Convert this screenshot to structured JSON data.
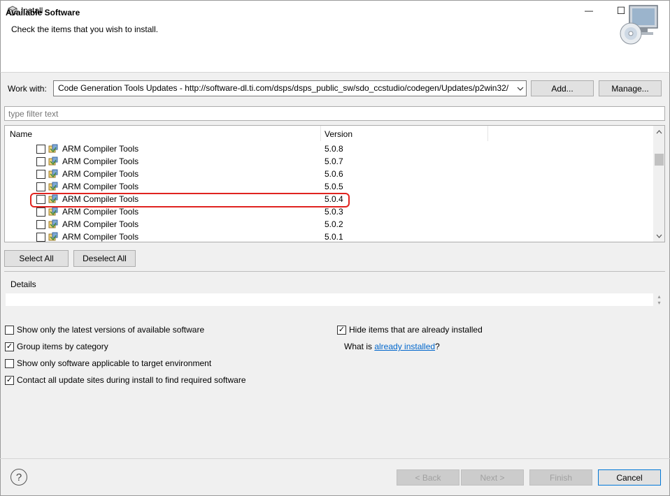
{
  "window": {
    "title": "Install",
    "minimize_glyph": "—",
    "maximize_glyph": "☐",
    "close_glyph": "✕"
  },
  "banner": {
    "title": "Available Software",
    "subtitle": "Check the items that you wish to install.",
    "icon": "install-cd-computer-icon"
  },
  "work_with": {
    "label": "Work with:",
    "value": "Code Generation Tools Updates - http://software-dl.ti.com/dsps/dsps_public_sw/sdo_ccstudio/codegen/Updates/p2win32/",
    "add_label": "Add...",
    "manage_label": "Manage..."
  },
  "filter": {
    "placeholder": "type filter text"
  },
  "table": {
    "columns": [
      "Name",
      "Version"
    ],
    "rows": [
      {
        "name": "ARM Compiler Tools",
        "version": "5.0.8",
        "checked": false,
        "highlighted": false
      },
      {
        "name": "ARM Compiler Tools",
        "version": "5.0.7",
        "checked": false,
        "highlighted": false
      },
      {
        "name": "ARM Compiler Tools",
        "version": "5.0.6",
        "checked": false,
        "highlighted": false
      },
      {
        "name": "ARM Compiler Tools",
        "version": "5.0.5",
        "checked": false,
        "highlighted": false
      },
      {
        "name": "ARM Compiler Tools",
        "version": "5.0.4",
        "checked": false,
        "highlighted": true
      },
      {
        "name": "ARM Compiler Tools",
        "version": "5.0.3",
        "checked": false,
        "highlighted": false
      },
      {
        "name": "ARM Compiler Tools",
        "version": "5.0.2",
        "checked": false,
        "highlighted": false
      },
      {
        "name": "ARM Compiler Tools",
        "version": "5.0.1",
        "checked": false,
        "highlighted": false
      }
    ],
    "highlight_color": "#e0231f"
  },
  "selection": {
    "select_all": "Select All",
    "deselect_all": "Deselect All"
  },
  "details": {
    "label": "Details"
  },
  "options": {
    "latest_versions": {
      "label": "Show only the latest versions of available software",
      "checked": false
    },
    "group_by_category": {
      "label": "Group items by category",
      "checked": true
    },
    "target_env": {
      "label": "Show only software applicable to target environment",
      "checked": false
    },
    "contact_sites": {
      "label": "Contact all update sites during install to find required software",
      "checked": true
    },
    "hide_installed": {
      "label": "Hide items that are already installed",
      "checked": true
    },
    "what_is_prefix": "What is ",
    "what_is_link": "already installed",
    "what_is_suffix": "?"
  },
  "footer": {
    "back": "< Back",
    "next": "Next >",
    "finish": "Finish",
    "cancel": "Cancel",
    "help_glyph": "?"
  }
}
